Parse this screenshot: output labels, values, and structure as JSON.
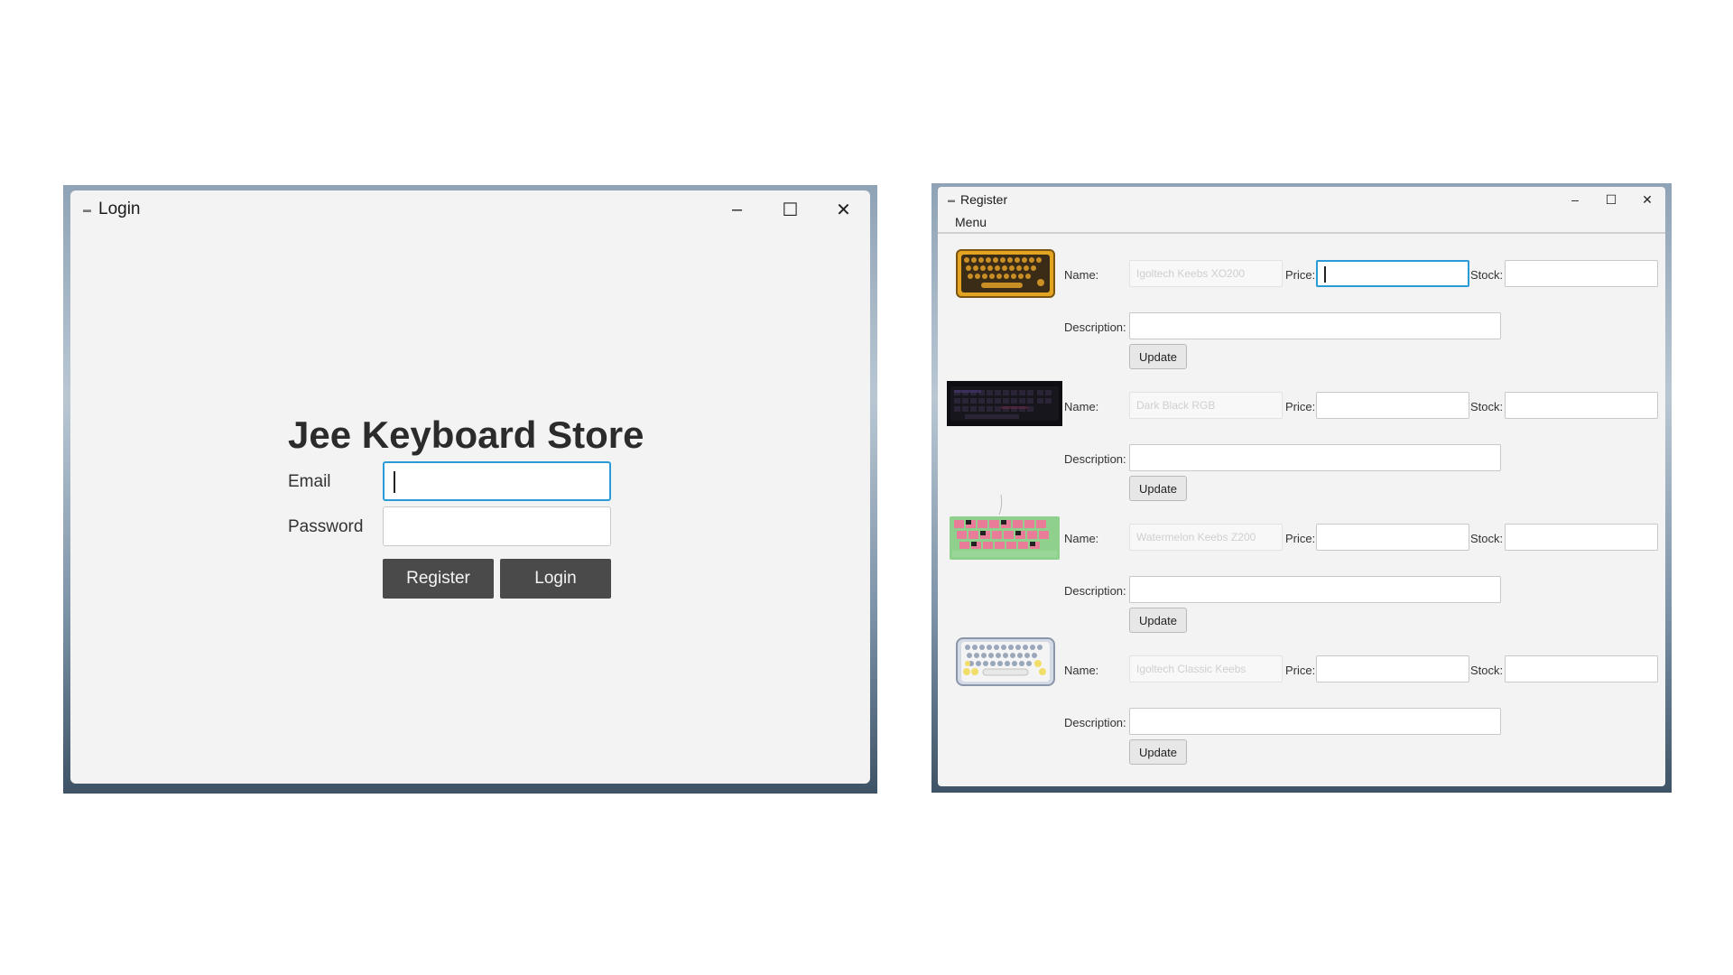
{
  "login_window": {
    "title": "Login",
    "store_title": "Jee Keyboard Store",
    "email_label": "Email",
    "email_value": "",
    "password_label": "Password",
    "password_value": "",
    "register_button": "Register",
    "login_button": "Login",
    "controls": {
      "minimize": "–",
      "maximize": "☐",
      "close": "✕"
    }
  },
  "register_window": {
    "title": "Register",
    "menu": "Menu",
    "controls": {
      "minimize": "–",
      "maximize": "☐",
      "close": "✕"
    },
    "labels": {
      "name": "Name:",
      "price": "Price:",
      "stock": "Stock:",
      "description": "Description:",
      "update": "Update"
    },
    "products": [
      {
        "name_placeholder": "Igoltech Keebs XO200",
        "price": "",
        "stock": "",
        "description": "",
        "image": "yellow-retro-keyboard"
      },
      {
        "name_placeholder": "Dark Black RGB",
        "price": "",
        "stock": "",
        "description": "",
        "image": "black-rgb-keyboard"
      },
      {
        "name_placeholder": "Watermelon Keebs Z200",
        "price": "",
        "stock": "",
        "description": "",
        "image": "watermelon-keyboard"
      },
      {
        "name_placeholder": "Igoltech Classic Keebs",
        "price": "",
        "stock": "",
        "description": "",
        "image": "round-key-keyboard"
      }
    ]
  },
  "colors": {
    "focus_border": "#2b9bd8",
    "dark_button": "#4a4a4a",
    "window_bg": "#f3f3f3"
  }
}
